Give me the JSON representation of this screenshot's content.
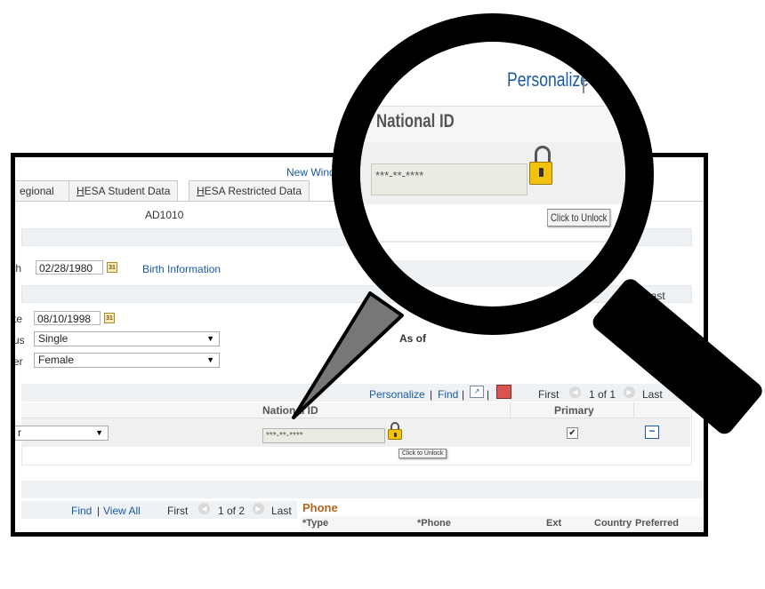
{
  "header": {
    "new_window_link": "New Window"
  },
  "tabs": [
    {
      "label": "Regional",
      "visible": "egional"
    },
    {
      "label": "HESA Student Data",
      "accel": "H",
      "rest": "ESA Student Data"
    },
    {
      "label": "HESA Restricted Data",
      "accel": "H",
      "rest": "ESA Restricted Data"
    }
  ],
  "person": {
    "id": "AD1010"
  },
  "birth": {
    "label_fragment": "th",
    "date": "02/28/1980",
    "info_link": "Birth Information"
  },
  "status_section": {
    "date_label_fragment": "te",
    "date": "08/10/1998",
    "marital_label_fragment": "us",
    "marital_value": "Single",
    "gender_label_fragment": "er",
    "gender_value": "Female",
    "as_of_label": "As of",
    "last_label": "Last"
  },
  "national_id_grid": {
    "personalize": "Personalize",
    "find": "Find",
    "first": "First",
    "range": "1 of 1",
    "last": "Last",
    "col_national_id": "National ID",
    "col_primary": "Primary",
    "country_fragment": "r",
    "national_id_value": "***-**-****",
    "primary_checked": true,
    "tooltip": "Click to Unlock"
  },
  "bottom_grid": {
    "find": "Find",
    "view_all": "View All",
    "first": "First",
    "range": "1 of 2",
    "last": "Last"
  },
  "phone": {
    "title": "Phone",
    "col_type": "*Type",
    "col_phone": "*Phone",
    "col_ext": "Ext",
    "col_country": "Country",
    "col_preferred": "Preferred"
  },
  "magnified": {
    "personalize": "Personalize",
    "national_id_header": "National ID",
    "national_id_value": "***-**-****",
    "tooltip": "Click to Unlock"
  },
  "colors": {
    "link": "#1a5aa6",
    "lock_yellow": "#f4c20d",
    "phone_title": "#b5651d"
  }
}
